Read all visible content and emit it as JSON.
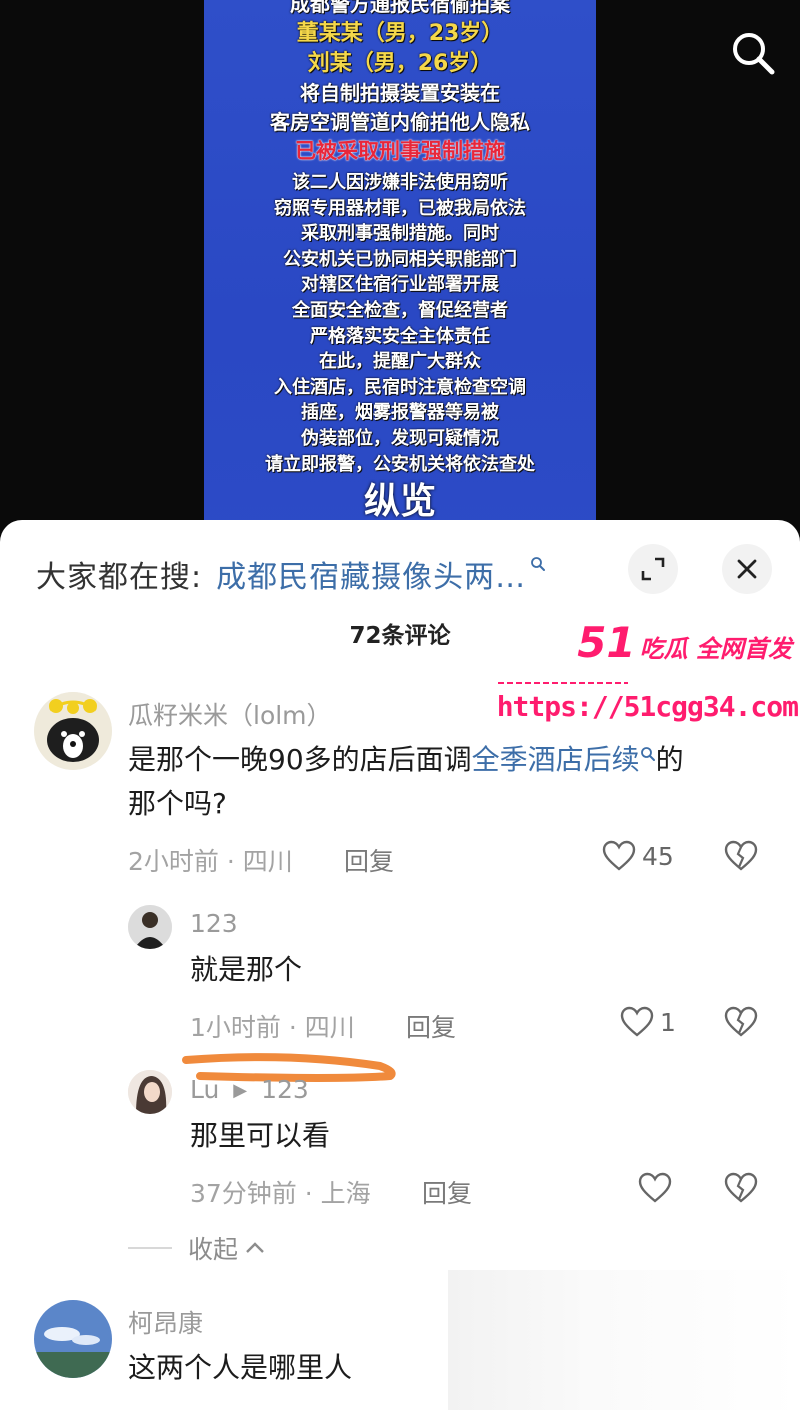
{
  "poster": {
    "headline": [
      "成都警方通报民宿偷拍案",
      "董某某（男，23岁）",
      "刘某（男，26岁）",
      "将自制拍摄装置安装在",
      "客房空调管道内偷拍他人隐私",
      "已被采取刑事强制措施"
    ],
    "body": [
      "该二人因涉嫌非法使用窃听",
      "窃照专用器材罪，已被我局依法",
      "采取刑事强制措施。同时",
      "公安机关已协同相关职能部门",
      "对辖区住宿行业部署开展",
      "全面安全检查，督促经营者",
      "严格落实安全主体责任",
      "在此，提醒广大群众",
      "入住酒店，民宿时注意检查空调",
      "插座，烟雾报警器等易被",
      "伪装部位，发现可疑情况",
      "请立即报警，公安机关将依法查处"
    ],
    "logo": "纵览"
  },
  "search_suggest": {
    "prefix": "大家都在搜:",
    "term": "成都民宿藏摄像头两…"
  },
  "comments_header": {
    "count_label": "72条评论"
  },
  "watermark": {
    "brand": "51",
    "tagline": "吃瓜 全网首发",
    "url": "https://51cgg34.com"
  },
  "comments": [
    {
      "author": "瓜籽米米（lolm）",
      "text_before": "是那个一晚90多的店后面调",
      "link_term": "全季酒店后续",
      "text_after": "的",
      "text_line2": "那个吗?",
      "time": "2小时前 · 四川",
      "reply_label": "回复",
      "likes": "45"
    },
    {
      "author": "123",
      "text": "就是那个",
      "time": "1小时前 · 四川",
      "reply_label": "回复",
      "likes": "1"
    },
    {
      "author": "Lu",
      "reply_to": "123",
      "text": "那里可以看",
      "time": "37分钟前 · 上海",
      "reply_label": "回复",
      "likes": ""
    },
    {
      "author": "柯昂康",
      "text": "这两个人是哪里人"
    }
  ],
  "collapse_label": "收起",
  "colors": {
    "link": "#3d6ea8",
    "watermark": "#ff1c6e",
    "poster_bg": "#2c4bc6",
    "highlight_red": "#e8263a",
    "highlight_yellow": "#f5d84a"
  }
}
